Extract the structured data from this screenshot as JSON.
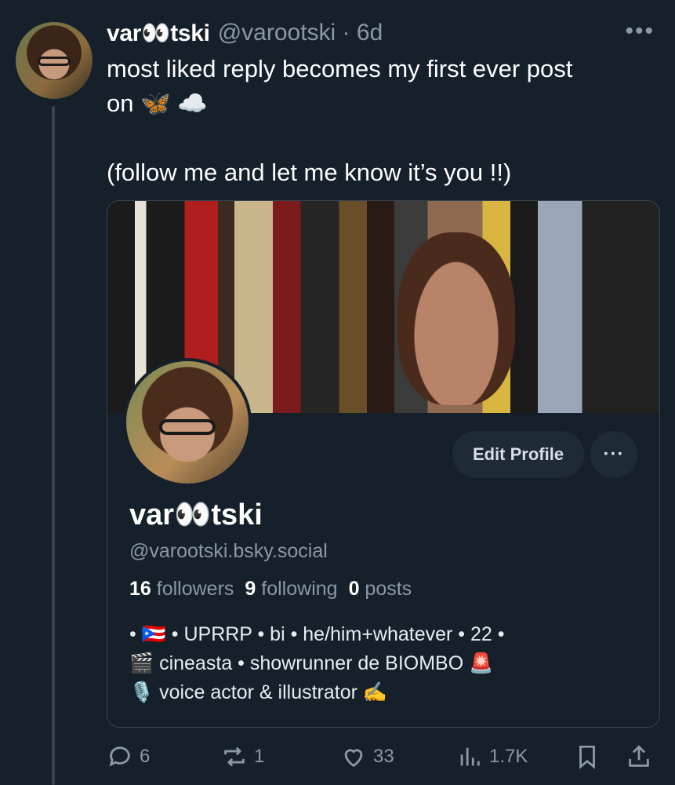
{
  "post": {
    "author_name": "var👀tski",
    "author_handle": "@varootski",
    "separator": "·",
    "age": "6d",
    "text": "most liked reply becomes my first ever post\non 🦋 ☁️\n\n(follow me and let me know it’s you !!)"
  },
  "card": {
    "edit_label": "Edit Profile",
    "more_label": "···",
    "name": "var👀tski",
    "handle": "@varootski.bsky.social",
    "followers_count": "16",
    "followers_label": "followers",
    "following_count": "9",
    "following_label": "following",
    "posts_count": "0",
    "posts_label": "posts",
    "bio": "• 🇵🇷 • UPRRP • bi • he/him+whatever • 22 •\n🎬 cineasta • showrunner de BIOMBO 🚨\n🎙️ voice actor & illustrator ✍️"
  },
  "actions": {
    "replies": "6",
    "reposts": "1",
    "likes": "33",
    "views": "1.7K"
  },
  "icons": [
    "reply-icon",
    "repost-icon",
    "like-icon",
    "views-icon",
    "bookmark-icon",
    "share-icon"
  ],
  "colors": {
    "background": "#15202b",
    "muted": "#8b98a5",
    "border": "#38444d",
    "button": "#1e2a36"
  }
}
